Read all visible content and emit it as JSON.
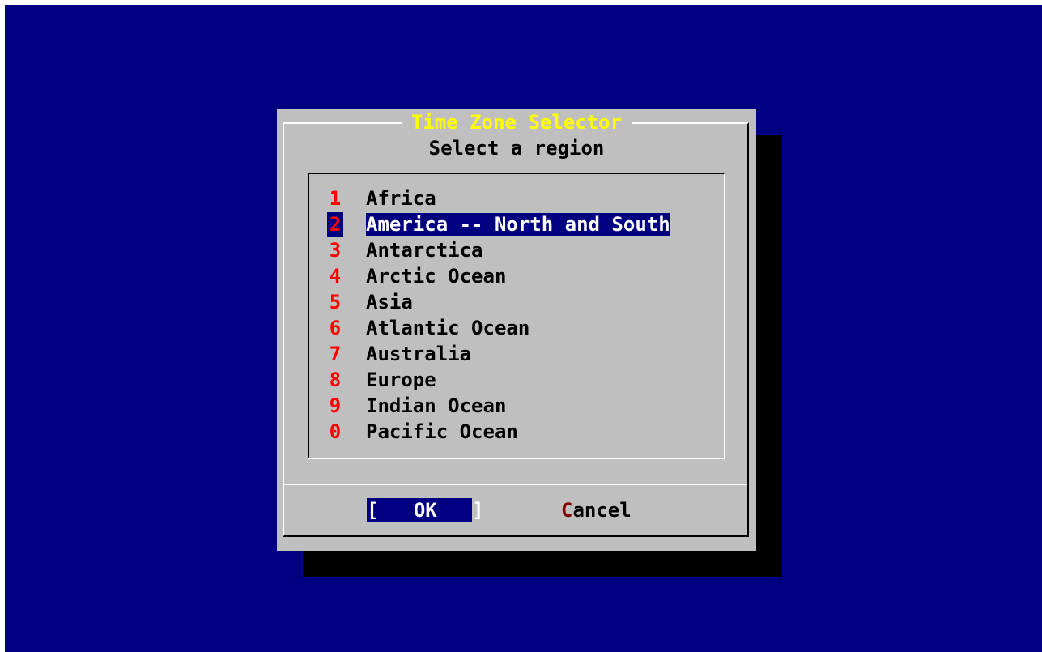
{
  "dialog": {
    "title": "Time Zone Selector",
    "prompt": "Select a region"
  },
  "regions": [
    {
      "key": "1",
      "label": "Africa"
    },
    {
      "key": "2",
      "label": "America -- North and South"
    },
    {
      "key": "3",
      "label": "Antarctica"
    },
    {
      "key": "4",
      "label": "Arctic Ocean"
    },
    {
      "key": "5",
      "label": "Asia"
    },
    {
      "key": "6",
      "label": "Atlantic Ocean"
    },
    {
      "key": "7",
      "label": "Australia"
    },
    {
      "key": "8",
      "label": "Europe"
    },
    {
      "key": "9",
      "label": "Indian Ocean"
    },
    {
      "key": "0",
      "label": "Pacific Ocean"
    }
  ],
  "selected_region": "America -- North and South",
  "buttons": {
    "ok_open": "[",
    "ok_label": "OK",
    "ok_close": "]",
    "cancel_hotkey": "C",
    "cancel_rest": "ancel"
  },
  "colors": {
    "background": "#000080",
    "dialog": "#bfbfbf",
    "title": "#ffff00",
    "hotkey": "#ff0000",
    "selection": "#000080"
  }
}
